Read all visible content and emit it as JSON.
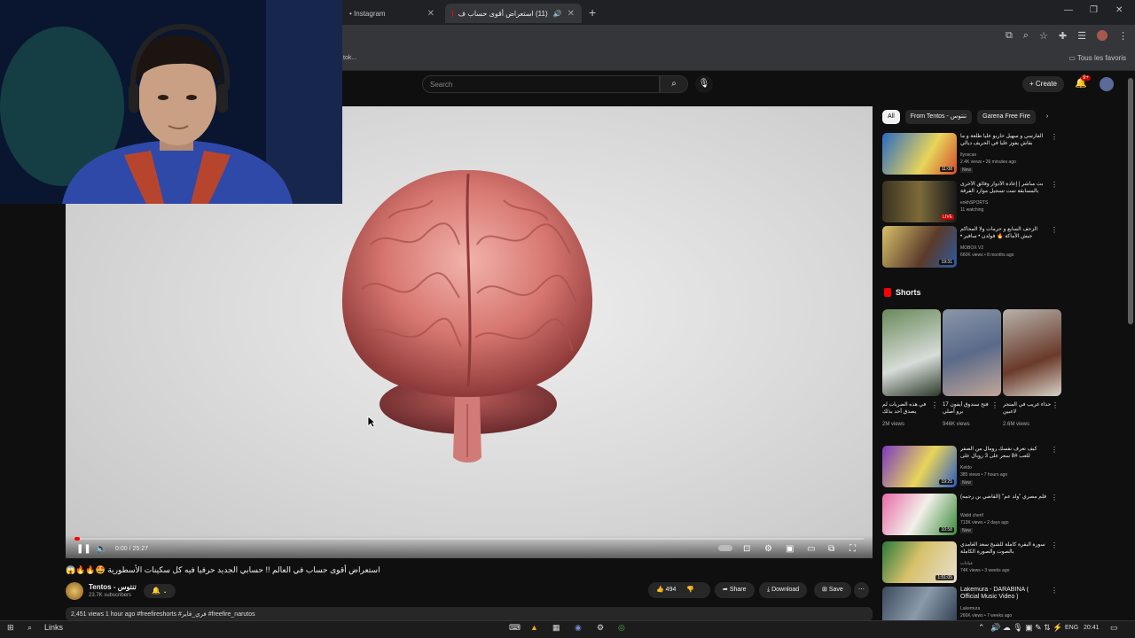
{
  "browser": {
    "tabs": [
      {
        "label": "• Instagram",
        "close": "✕"
      },
      {
        "label": "(11) استعراض أقوى حساب ف",
        "close": "✕"
      }
    ],
    "new_tab": "+",
    "window_controls": {
      "minimize": "—",
      "maximize": "❐",
      "close": "✕"
    },
    "bookmark_text": "tok...",
    "bookmarks_all": "Tous les favoris"
  },
  "header": {
    "search_placeholder": "Search",
    "create_label": "Create",
    "notification_count": "9+"
  },
  "player": {
    "time": "0:00 / 25:27",
    "progress": 0.0
  },
  "video": {
    "title": "استعراض أقوى حساب في العالم !! حسابي الجديد حرفيا فيه كل سكينات الأسطورية 🤩🔥🔥😱",
    "channel": "Tentos - تنتوس",
    "subscribers": "23.7K subscribers",
    "likes": "494",
    "share": "Share",
    "download": "Download",
    "save": "Save",
    "description": "2,451 views  1 hour ago  #freefireshorts #فري_فاير #freefire_narutos"
  },
  "sidebar": {
    "chips": [
      "All",
      "From Tentos - تنتوس",
      "Garena Free Fire"
    ],
    "recommended_top": [
      {
        "title": "الفارسي و سهيل حاربو عليا طلعة و ما بقاش يفوز عليا في الحريف ديالي",
        "channel": "Ilyoscas",
        "meta": "2.4K views • 26 minutes ago",
        "badge": "New",
        "duration": "11:08"
      },
      {
        "title": "بث مباشر | إعادة الأدوار وفائق الأخرى بالمسابقة تمت تسجيل موارد الفرقة الأخرى",
        "channel": "enkhSPORTS",
        "meta": "11 watching",
        "badge": "",
        "duration": "LIVE"
      },
      {
        "title": "الزحف السابع و حرمات ولا المحاكم جيش الأماكة 🔥 فولدن • سافير • ماسورتي",
        "channel": "MOBOX V2",
        "meta": "660K views • 8 months ago",
        "badge": "",
        "duration": "19:31"
      }
    ],
    "shorts_header": "Shorts",
    "shorts": [
      {
        "title": "في هذه الضربات لم يصدق أحد بذلك",
        "views": "2M views"
      },
      {
        "title": "فتح سندوق أيفون 17 برو أصلي",
        "views": "946K views"
      },
      {
        "title": "حذاء غريب في المتجر لاعبين",
        "views": "2.6M views"
      }
    ],
    "recommended_bottom": [
      {
        "title": "كيف تعرف نفسك رومال من الصفر للعب #8 سعر على 3 روبال على",
        "channel": "Keldo",
        "meta": "385 views • 7 hours ago",
        "badge": "New",
        "duration": "19:25"
      },
      {
        "title": "فلم مصري \"ولد عم\" (القاضي بن رحمه)",
        "channel": "Walid cherif",
        "meta": "713K views • 2 days ago",
        "badge": "New",
        "duration": "10:58"
      },
      {
        "title": "سورة البقرة كاملة للشيخ سعد الغامدي بالصوت والصورة الكاملة",
        "channel": "عبادات",
        "meta": "74K views • 3 weeks ago",
        "badge": "",
        "duration": "1:51:05"
      },
      {
        "title": "Lakemura - DARABINA ( Official Music Video )",
        "channel": "Lakemura",
        "meta": "266K views • 7 weeks ago",
        "badge": "",
        "duration": ""
      }
    ]
  },
  "taskbar": {
    "links": "Links",
    "lang": "ENG",
    "clock": "20:41"
  }
}
